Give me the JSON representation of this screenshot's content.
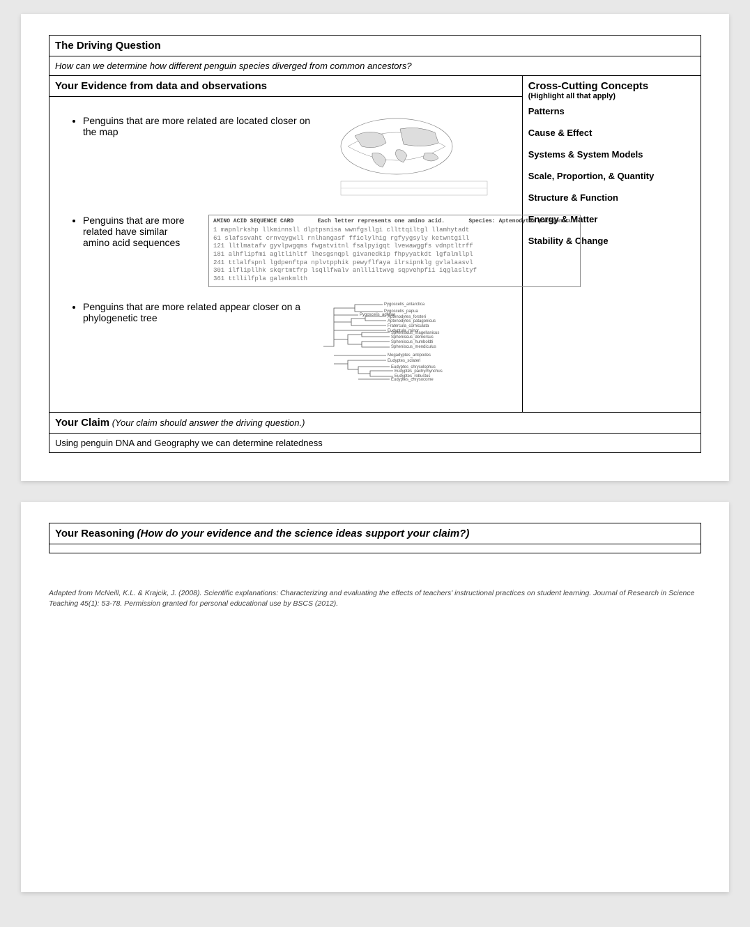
{
  "sections": {
    "driving_question_label": "The Driving Question",
    "driving_question": "How can we determine how different penguin species diverged from common ancestors?",
    "evidence_label": "Your Evidence from data and observations",
    "ccc_label": "Cross-Cutting Concepts",
    "ccc_sub": "(Highlight all that apply)",
    "claim_label": "Your Claim",
    "claim_hint": "(Your claim should answer the driving question.)",
    "claim_text": "Using penguin DNA and Geography we can determine relatedness",
    "reasoning_label": "Your Reasoning",
    "reasoning_hint": "(How do your evidence and the science ideas support your claim?)"
  },
  "evidence": {
    "item1": "Penguins that are more related are located closer on the map",
    "item2": "Penguins that are more related have similar amino acid sequences",
    "item3": "Penguins that are more related appear closer on a phylogenetic tree"
  },
  "ccc": {
    "c1": "Patterns",
    "c2": "Cause & Effect",
    "c3": "Systems & System Models",
    "c4": "Scale, Proportion, & Quantity",
    "c5": "Structure & Function",
    "c6": "Energy & Matter",
    "c7": "Stability & Change"
  },
  "seq_card": {
    "title": "AMINO ACID SEQUENCE CARD",
    "subtitle": "Each letter represents one amino acid.",
    "species_label": "Species:",
    "species": "Aptenodytes patagonicus",
    "l1_num": "1",
    "l1": "mapnlrkshp llkminnsll dlptpsnisa wwnfgsllgi cllttqiltgl llamhytadt",
    "l2_num": "61",
    "l2": "slafssvaht crnvqygwll rnlhangasf fficlylhig rgfyygsyly ketwntgill",
    "l3_num": "121",
    "l3": "lltlmatafv gyvlpwgqms fwgatvitnl fsalpyigqt lvewawggfs vdnptltrff",
    "l4_num": "181",
    "l4": "alhflipfmi agltlihltf lhesgsnqpl givanedkip fhpyyatkdt lgfalmllpl",
    "l5_num": "241",
    "l5": "ttlalfspnl lgdpenftpa nplvtpphik pewyflfaya ilrsipnklg gvlalaasvl",
    "l6_num": "301",
    "l6": "ilflipllhk skqrtmtfrp lsqllfwalv anllliltwvg sqpvehpfii iqglasltyf",
    "l7_num": "361",
    "l7": "ttllilfpla galenkmlth"
  },
  "tree": {
    "sp1": "Pygoscelis_antarctica",
    "sp2": "Pygoscelis_papua",
    "sp3": "Pygoscelis_adeliae",
    "sp4": "Aptenodytes_forsteri",
    "sp5": "Aptenodytes_patagonicus",
    "sp6": "Fratercula_corniculata",
    "sp7": "Eudyptula_minor",
    "sp8": "Spheniscus_magellanicus",
    "sp9": "Spheniscus_demersus",
    "sp10": "Spheniscus_humboldti",
    "sp11": "Spheniscus_mendiculus",
    "sp12": "Megadyptes_antipodes",
    "sp13": "Eudyptes_sclateri",
    "sp14": "Eudyptes_chrysolophus",
    "sp15": "Eudyptes_pachyrhynchus",
    "sp16": "Eudyptes_robustus",
    "sp17": "Eudyptes_chrysocome"
  },
  "citation": "Adapted from McNeill, K.L. & Krajcik, J. (2008). Scientific explanations: Characterizing and evaluating the effects of teachers' instructional practices on student learning. Journal of Research in Science Teaching 45(1): 53-78. Permission granted for personal educational use by BSCS (2012)."
}
